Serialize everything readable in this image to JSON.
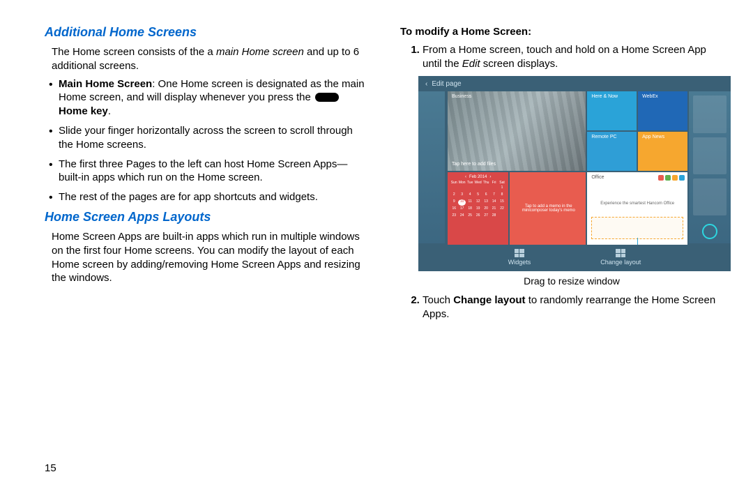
{
  "pageNumber": "15",
  "left": {
    "heading1": "Additional Home Screens",
    "intro_a": "The Home screen consists of the a ",
    "intro_i": "main Home screen",
    "intro_b": " and up to 6 additional screens.",
    "b1_strong": "Main Home Screen",
    "b1_rest": ": One Home screen is designated as the main Home screen, and will display whenever you press the ",
    "b1_key": "Home key",
    "b2": "Slide your finger horizontally across the screen to scroll through the Home screens.",
    "b3": "The first three Pages to the left can host Home Screen Apps—built-in apps which run on the Home screen.",
    "b4": "The rest of the pages are for app shortcuts and widgets.",
    "heading2": "Home Screen Apps Layouts",
    "para2": "Home Screen Apps are built-in apps which run in multiple windows on the first four Home screens. You can modify the layout of each Home screen by adding/removing Home Screen Apps and resizing the windows."
  },
  "right": {
    "subheading": "To modify a Home Screen:",
    "step1_a": "From a Home screen, touch and hold on a Home Screen App until the ",
    "step1_i": "Edit",
    "step1_b": " screen displays.",
    "step2_a": "Touch ",
    "step2_strong": "Change layout",
    "step2_b": " to randomly rearrange the Home Screen Apps.",
    "caption": "Drag to resize window"
  },
  "illus": {
    "editPage": "Edit page",
    "tiles": {
      "business": "Business",
      "here": "Here & Now",
      "webex": "WebEx",
      "remotepc": "Remote PC",
      "app": "App News",
      "tap": "Tap here to add files",
      "office": "Office",
      "officeText": "Experience the smartest Hancom Office",
      "noteText": "Tap to add a memo in the minicomposer today's memo"
    },
    "cal": {
      "month": "Feb 2014",
      "days": [
        "Sun",
        "Mon",
        "Tue",
        "Wed",
        "Thu",
        "Fri",
        "Sat"
      ]
    },
    "bottom": {
      "widgets": "Widgets",
      "change": "Change layout"
    }
  }
}
